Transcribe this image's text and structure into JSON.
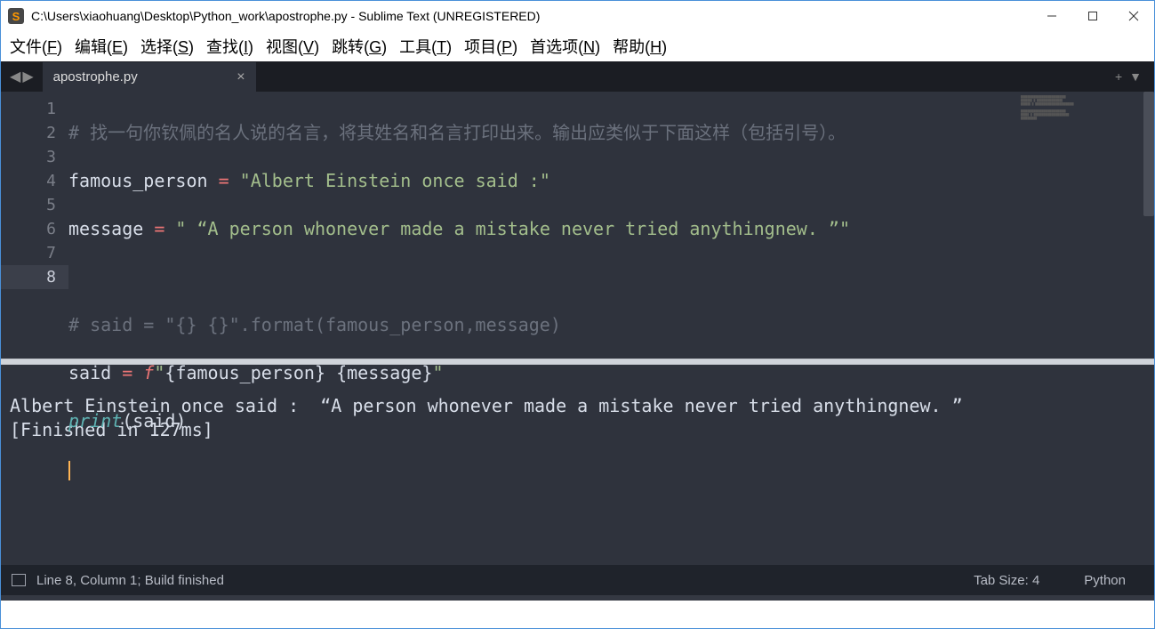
{
  "window": {
    "title": "C:\\Users\\xiaohuang\\Desktop\\Python_work\\apostrophe.py - Sublime Text (UNREGISTERED)",
    "app_icon_letter": "S"
  },
  "menu": {
    "file": "文件",
    "file_u": "F",
    "edit": "编辑",
    "edit_u": "E",
    "select": "选择",
    "select_u": "S",
    "find": "查找",
    "find_u": "I",
    "view": "视图",
    "view_u": "V",
    "goto": "跳转",
    "goto_u": "G",
    "tools": "工具",
    "tools_u": "T",
    "project": "项目",
    "project_u": "P",
    "prefs": "首选项",
    "prefs_u": "N",
    "help": "帮助",
    "help_u": "H"
  },
  "tabs": {
    "active": "apostrophe.py"
  },
  "gutter": [
    "1",
    "2",
    "3",
    "4",
    "5",
    "6",
    "7",
    "8"
  ],
  "code": {
    "l1_comment": "# 找一句你钦佩的名人说的名言，将其姓名和名言打印出来。输出应类似于下面这样（包括引号）。",
    "l2_var": "famous_person",
    "l2_eq": " = ",
    "l2_str": "\"Albert Einstein once said :\"",
    "l3_var": "message",
    "l3_eq": " = ",
    "l3_str": "\" “A person whonever made a mistake never tried anythingnew. ”\"",
    "l5_comment": "# said = \"{} {}\".format(famous_person,message)",
    "l6_var": "said",
    "l6_eq": " = ",
    "l6_fprefix": "f",
    "l6_q1": "\"",
    "l6_b1": "{",
    "l6_fp": "famous_person",
    "l6_b2": "}",
    "l6_sp": " ",
    "l6_b3": "{",
    "l6_msg": "message",
    "l6_b4": "}",
    "l6_q2": "\"",
    "l7_fn": "print",
    "l7_paren_open": "(",
    "l7_arg": "said",
    "l7_paren_close": ")"
  },
  "console": {
    "line1": "Albert Einstein once said :  “A person whonever made a mistake never tried anythingnew. ”",
    "line2": "[Finished in 127ms]"
  },
  "status": {
    "left": "Line 8, Column 1; Build finished",
    "tab_size": "Tab Size: 4",
    "lang": "Python"
  }
}
